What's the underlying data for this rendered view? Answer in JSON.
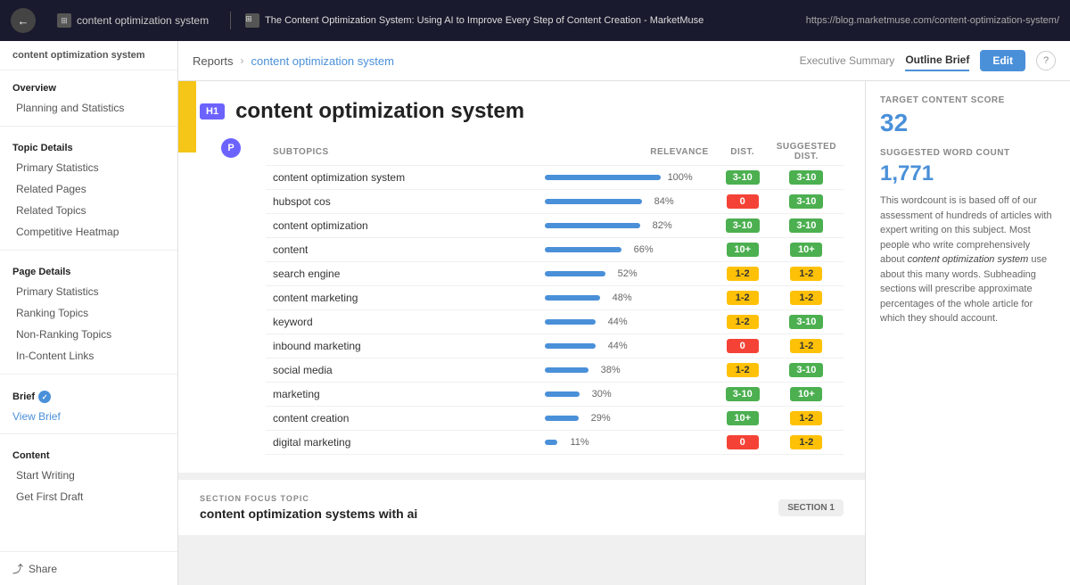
{
  "topbar": {
    "back_icon": "←",
    "tab1_icon": "□",
    "tab1_label": "content optimization system",
    "tab2_icon": "□",
    "tab2_title": "The Content Optimization System: Using AI to Improve Every Step of Content Creation - MarketMuse",
    "url": "https://blog.marketmuse.com/content-optimization-system/"
  },
  "header": {
    "reports_label": "Reports",
    "breadcrumb_label": "content optimization system",
    "tab_executive": "Executive Summary",
    "tab_outline": "Outline Brief",
    "edit_btn": "Edit"
  },
  "sidebar": {
    "brand": "content optimization system",
    "overview_label": "Overview",
    "planning_label": "Planning and Statistics",
    "topic_details_label": "Topic Details",
    "primary_stats_label": "Primary Statistics",
    "related_pages_label": "Related Pages",
    "related_topics_label": "Related Topics",
    "competitive_label": "Competitive Heatmap",
    "page_details_label": "Page Details",
    "page_primary_label": "Primary Statistics",
    "ranking_topics_label": "Ranking Topics",
    "non_ranking_label": "Non-Ranking Topics",
    "in_content_label": "In-Content Links",
    "brief_label": "Brief",
    "view_brief_label": "View Brief",
    "content_label": "Content",
    "start_writing_label": "Start Writing",
    "get_draft_label": "Get First Draft",
    "share_label": "Share"
  },
  "doc": {
    "h1_badge": "H1",
    "h1_title": "content optimization system",
    "p_badge": "P",
    "subtopics_header": "SUBTOPICS",
    "relevance_header": "RELEVANCE",
    "dist_header": "DIST.",
    "suggested_dist_header": "SUGGESTED DIST.",
    "rows": [
      {
        "topic": "content optimization system",
        "relevance": 100,
        "dist": "3-10",
        "dist_color": "green",
        "suggested": "3-10",
        "sug_color": "green"
      },
      {
        "topic": "hubspot cos",
        "relevance": 84,
        "dist": "0",
        "dist_color": "red",
        "suggested": "3-10",
        "sug_color": "green"
      },
      {
        "topic": "content optimization",
        "relevance": 82,
        "dist": "3-10",
        "dist_color": "green",
        "suggested": "3-10",
        "sug_color": "green"
      },
      {
        "topic": "content",
        "relevance": 66,
        "dist": "10+",
        "dist_color": "green",
        "suggested": "10+",
        "sug_color": "green"
      },
      {
        "topic": "search engine",
        "relevance": 52,
        "dist": "1-2",
        "dist_color": "yellow",
        "suggested": "1-2",
        "sug_color": "yellow"
      },
      {
        "topic": "content marketing",
        "relevance": 48,
        "dist": "1-2",
        "dist_color": "yellow",
        "suggested": "1-2",
        "sug_color": "yellow"
      },
      {
        "topic": "keyword",
        "relevance": 44,
        "dist": "1-2",
        "dist_color": "yellow",
        "suggested": "3-10",
        "sug_color": "green"
      },
      {
        "topic": "inbound marketing",
        "relevance": 44,
        "dist": "0",
        "dist_color": "red",
        "suggested": "1-2",
        "sug_color": "yellow"
      },
      {
        "topic": "social media",
        "relevance": 38,
        "dist": "1-2",
        "dist_color": "yellow",
        "suggested": "3-10",
        "sug_color": "green"
      },
      {
        "topic": "marketing",
        "relevance": 30,
        "dist": "3-10",
        "dist_color": "green",
        "suggested": "10+",
        "sug_color": "green"
      },
      {
        "topic": "content creation",
        "relevance": 29,
        "dist": "10+",
        "dist_color": "green",
        "suggested": "1-2",
        "sug_color": "yellow"
      },
      {
        "topic": "digital marketing",
        "relevance": 11,
        "dist": "0",
        "dist_color": "red",
        "suggested": "1-2",
        "sug_color": "yellow"
      }
    ]
  },
  "section_focus": {
    "label": "SECTION FOCUS TOPIC",
    "topic": "content optimization systems with ai",
    "badge": "SECTION 1"
  },
  "right_panel": {
    "target_score_label": "TARGET CONTENT SCORE",
    "target_score": "32",
    "word_count_label": "SUGGESTED WORD COUNT",
    "word_count": "1,771",
    "description": "This wordcount is is based off of our assessment of hundreds of articles with expert writing on this subject. Most people who write comprehensively about content optimization system use about this many words. Subheading sections will prescribe approximate percentages of the whole article for which they should account.",
    "italic_phrase": "content optimization system"
  }
}
